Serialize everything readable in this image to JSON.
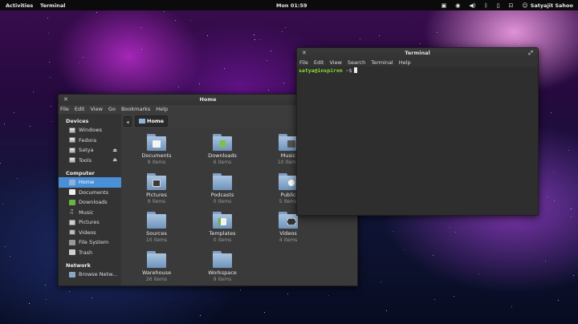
{
  "topbar": {
    "activities": "Activities",
    "app": "Terminal",
    "clock": "Mon 01:59",
    "user": "Satyajit Sahoo",
    "tray_icons": [
      "notification-icon",
      "accessibility-icon",
      "volume-icon",
      "bluetooth-icon",
      "battery-icon",
      "network-icon"
    ]
  },
  "files": {
    "title": "Home",
    "menu": [
      "File",
      "Edit",
      "View",
      "Go",
      "Bookmarks",
      "Help"
    ],
    "path": "Home",
    "sidebar": {
      "devices_header": "Devices",
      "devices": [
        "Windows",
        "Fedora",
        "Satya",
        "Tools"
      ],
      "computer_header": "Computer",
      "computer": [
        "Home",
        "Documents",
        "Downloads",
        "Music",
        "Pictures",
        "Videos",
        "File System",
        "Trash"
      ],
      "network_header": "Network",
      "network": [
        "Browse Netw..."
      ]
    },
    "items": [
      {
        "name": "Documents",
        "count": "9 items"
      },
      {
        "name": "Downloads",
        "count": "6 items"
      },
      {
        "name": "Music",
        "count": "10 items"
      },
      {
        "name": "Pictures",
        "count": "9 items"
      },
      {
        "name": "Podcasts",
        "count": "0 items"
      },
      {
        "name": "Public",
        "count": "5 items"
      },
      {
        "name": "Sources",
        "count": "10 items"
      },
      {
        "name": "Templates",
        "count": "0 items"
      },
      {
        "name": "Videos",
        "count": "4 items"
      },
      {
        "name": "Warehouse",
        "count": "26 items"
      },
      {
        "name": "Workspace",
        "count": "9 items"
      }
    ]
  },
  "terminal": {
    "title": "Terminal",
    "menu": [
      "File",
      "Edit",
      "View",
      "Search",
      "Terminal",
      "Help"
    ],
    "prompt_user": "satya@inspiron",
    "prompt_path": "~$"
  }
}
